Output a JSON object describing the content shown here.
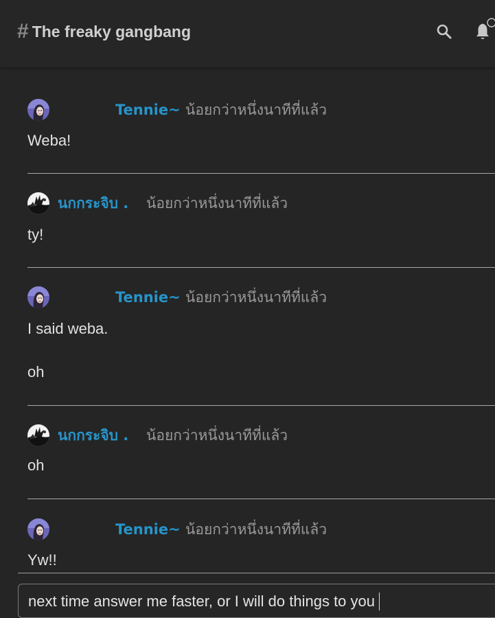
{
  "header": {
    "channel_name": "The freaky gangbang",
    "hash_icon": "hash-icon",
    "search_icon": "search-icon",
    "bell_icon": "bell-icon"
  },
  "messages": [
    {
      "author": "Tennie~",
      "time": "น้อยกว่าหนึ่งนาทีที่แล้ว",
      "lines": [
        "Weba!"
      ],
      "avatar": "tennie-avatar"
    },
    {
      "author": "นกกระจิบ .",
      "time": "น้อยกว่าหนึ่งนาทีที่แล้ว",
      "lines": [
        "ty!"
      ],
      "avatar": "nokkrajib-avatar"
    },
    {
      "author": "Tennie~",
      "time": "น้อยกว่าหนึ่งนาทีที่แล้ว",
      "lines": [
        "I said weba.",
        "oh"
      ],
      "avatar": "tennie-avatar"
    },
    {
      "author": "นกกระจิบ .",
      "time": "น้อยกว่าหนึ่งนาทีที่แล้ว",
      "lines": [
        "oh"
      ],
      "avatar": "nokkrajib-avatar"
    },
    {
      "author": "Tennie~",
      "time": "น้อยกว่าหนึ่งนาทีที่แล้ว",
      "lines": [
        "Yw!!"
      ],
      "avatar": "tennie-avatar"
    }
  ],
  "composer": {
    "value": "next time answer me faster, or I will do things to you"
  },
  "colors": {
    "background": "#252525",
    "author": "#2794c9",
    "timestamp": "#9a9a9a",
    "text": "#e2e2e2"
  }
}
